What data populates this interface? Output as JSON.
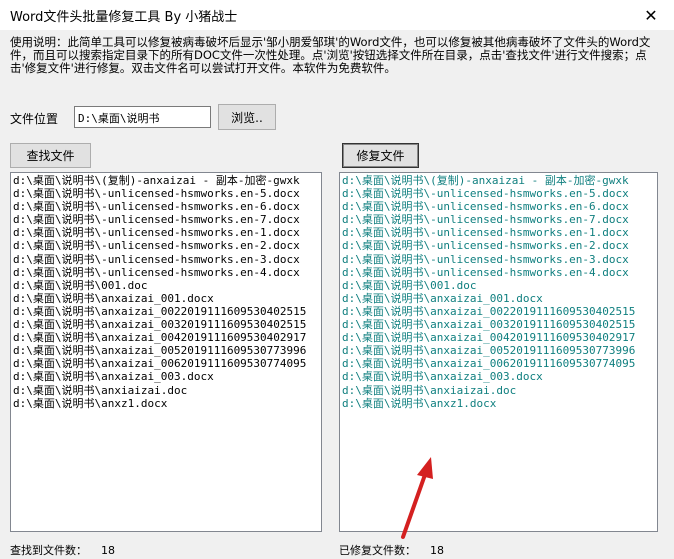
{
  "window": {
    "title": "Word文件头批量修复工具  By 小猪战士",
    "close_glyph": "✕"
  },
  "instructions": "使用说明：此简单工具可以修复被病毒破坏后显示'邹小朋爱邹琪'的Word文件，也可以修复被其他病毒破坏了文件头的Word文件，而且可以搜索指定目录下的所有DOC文件一次性处理。点'浏览'按钮选择文件所在目录，点击'查找文件'进行文件搜索；点击'修复文件'进行修复。双击文件名可以尝试打开文件。本软件为免费软件。",
  "location": {
    "label": "文件位置",
    "value": "D:\\桌面\\说明书"
  },
  "buttons": {
    "browse": "浏览..",
    "find": "查找文件",
    "repair": "修复文件"
  },
  "left_list": [
    "d:\\桌面\\说明书\\(复制)-anxaizai - 副本-加密-gwxk",
    "d:\\桌面\\说明书\\-unlicensed-hsmworks.en-5.docx",
    "d:\\桌面\\说明书\\-unlicensed-hsmworks.en-6.docx",
    "d:\\桌面\\说明书\\-unlicensed-hsmworks.en-7.docx",
    "d:\\桌面\\说明书\\-unlicensed-hsmworks.en-1.docx",
    "d:\\桌面\\说明书\\-unlicensed-hsmworks.en-2.docx",
    "d:\\桌面\\说明书\\-unlicensed-hsmworks.en-3.docx",
    "d:\\桌面\\说明书\\-unlicensed-hsmworks.en-4.docx",
    "d:\\桌面\\说明书\\001.doc",
    "d:\\桌面\\说明书\\anxaizai_001.docx",
    "d:\\桌面\\说明书\\anxaizai_0022019111609530402515",
    "d:\\桌面\\说明书\\anxaizai_0032019111609530402515",
    "d:\\桌面\\说明书\\anxaizai_0042019111609530402917",
    "d:\\桌面\\说明书\\anxaizai_0052019111609530773996",
    "d:\\桌面\\说明书\\anxaizai_0062019111609530774095",
    "d:\\桌面\\说明书\\anxaizai_003.docx",
    "d:\\桌面\\说明书\\anxiaizai.doc",
    "d:\\桌面\\说明书\\anxz1.docx"
  ],
  "right_list": [
    "d:\\桌面\\说明书\\(复制)-anxaizai - 副本-加密-gwxk",
    "d:\\桌面\\说明书\\-unlicensed-hsmworks.en-5.docx",
    "d:\\桌面\\说明书\\-unlicensed-hsmworks.en-6.docx",
    "d:\\桌面\\说明书\\-unlicensed-hsmworks.en-7.docx",
    "d:\\桌面\\说明书\\-unlicensed-hsmworks.en-1.docx",
    "d:\\桌面\\说明书\\-unlicensed-hsmworks.en-2.docx",
    "d:\\桌面\\说明书\\-unlicensed-hsmworks.en-3.docx",
    "d:\\桌面\\说明书\\-unlicensed-hsmworks.en-4.docx",
    "d:\\桌面\\说明书\\001.doc",
    "d:\\桌面\\说明书\\anxaizai_001.docx",
    "d:\\桌面\\说明书\\anxaizai_0022019111609530402515",
    "d:\\桌面\\说明书\\anxaizai_0032019111609530402515",
    "d:\\桌面\\说明书\\anxaizai_0042019111609530402917",
    "d:\\桌面\\说明书\\anxaizai_0052019111609530773996",
    "d:\\桌面\\说明书\\anxaizai_0062019111609530774095",
    "d:\\桌面\\说明书\\anxaizai_003.docx",
    "d:\\桌面\\说明书\\anxiaizai.doc",
    "d:\\桌面\\说明书\\anxz1.docx"
  ],
  "status": {
    "found_label": "查找到文件数：",
    "found_count": "18",
    "repaired_label": "已修复文件数：",
    "repaired_count": "18"
  },
  "colors": {
    "repaired_text": "#0f7f7f",
    "arrow": "#d42020"
  }
}
